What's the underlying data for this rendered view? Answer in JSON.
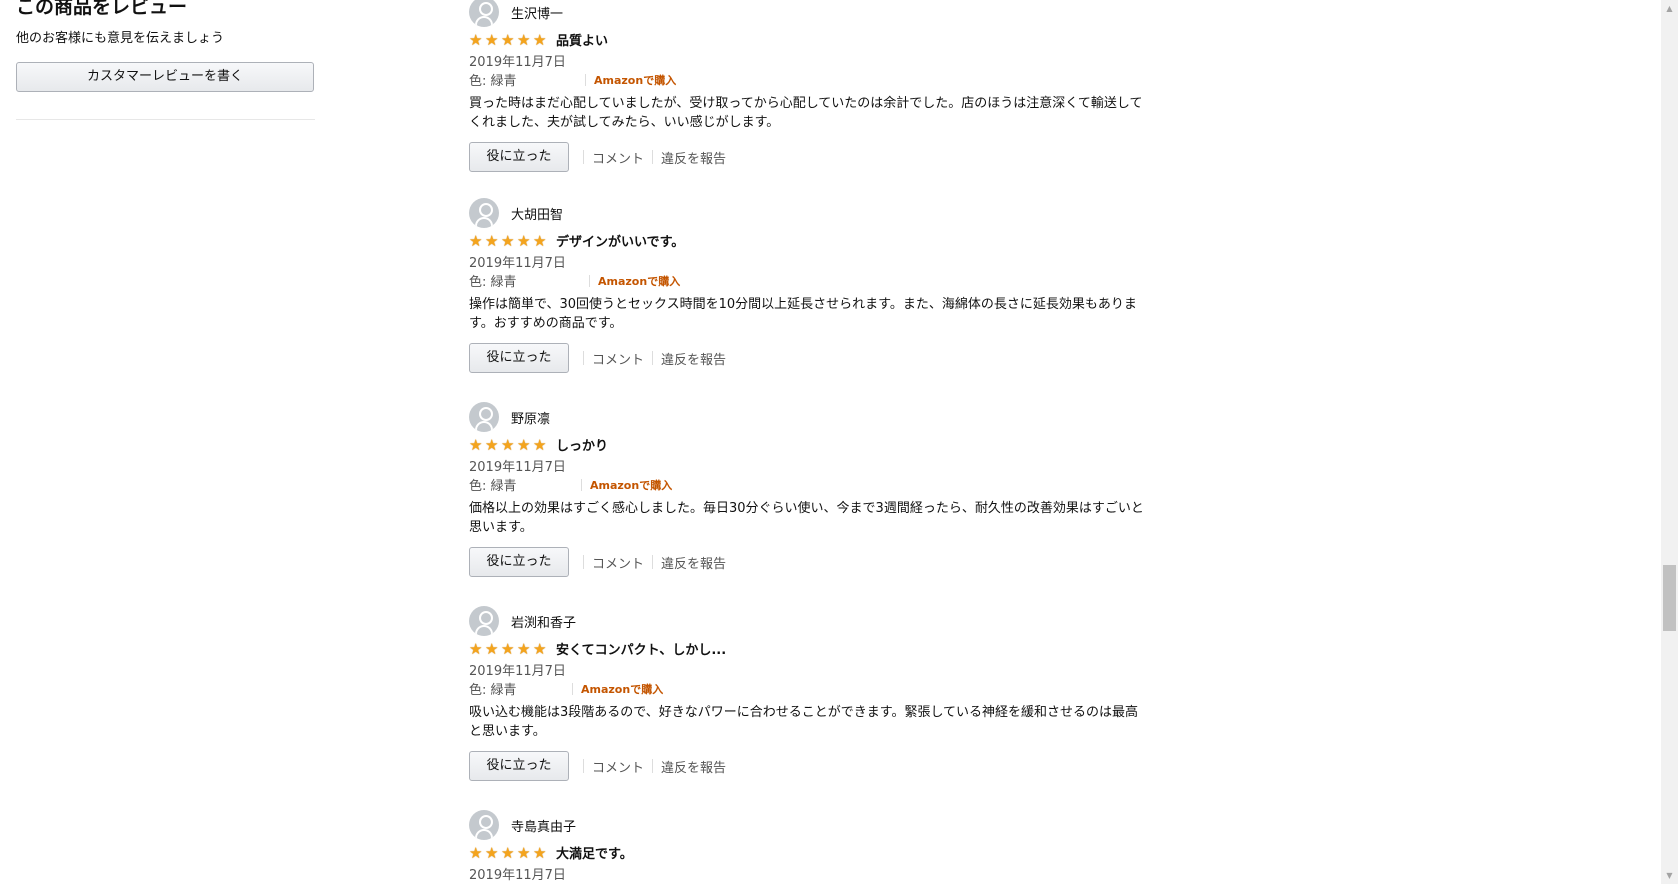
{
  "sidebar": {
    "heading": "この商品をレビュー",
    "subtext": "他のお客様にも意見を伝えましょう",
    "write_review_button": "カスタマーレビューを書く"
  },
  "reviews": [
    {
      "name": "生沢博一",
      "rating": 5,
      "title": "品質よい",
      "date": "2019年11月7日",
      "variant": "色: 緑青",
      "purchase": "Amazonで購入",
      "body": "買った時はまだ心配していましたが、受け取ってから心配していたのは余計でした。店のほうは注意深くて輸送してくれました、夫が試してみたら、いい感じがします。",
      "helpful": "役に立った",
      "comment": "コメント",
      "report": "違反を報告"
    },
    {
      "name": "大胡田智",
      "rating": 5,
      "title": "デザインがいいです。",
      "date": "2019年11月7日",
      "variant": "色: 緑青",
      "purchase": "Amazonで購入",
      "body": "操作は簡単で、30回使うとセックス時間を10分間以上延長させられます。また、海綿体の長さに延長効果もあります。おすすめの商品です。",
      "helpful": "役に立った",
      "comment": "コメント",
      "report": "違反を報告"
    },
    {
      "name": "野原凛",
      "rating": 5,
      "title": "しっかり",
      "date": "2019年11月7日",
      "variant": "色: 緑青",
      "purchase": "Amazonで購入",
      "body": "価格以上の効果はすごく感心しました。毎日30分ぐらい使い、今まで3週間経ったら、耐久性の改善効果はすごいと思います。",
      "helpful": "役に立った",
      "comment": "コメント",
      "report": "違反を報告"
    },
    {
      "name": "岩渕和香子",
      "rating": 5,
      "title": "安くてコンパクト、しかし...",
      "date": "2019年11月7日",
      "variant": "色: 緑青",
      "purchase": "Amazonで購入",
      "body": "吸い込む機能は3段階あるので、好きなパワーに合わせることができます。緊張している神経を緩和させるのは最高と思います。",
      "helpful": "役に立った",
      "comment": "コメント",
      "report": "違反を報告"
    },
    {
      "name": "寺島真由子",
      "rating": 5,
      "title": "大満足です。",
      "date": "2019年11月7日"
    }
  ],
  "icons": {
    "avatar": "user-silhouette",
    "star": "filled-star",
    "scroll_up": "triangle-up",
    "scroll_down": "triangle-down"
  },
  "colors": {
    "star": "#f4a41d",
    "verified": "#c45500",
    "button_border": "#adb1b8"
  }
}
